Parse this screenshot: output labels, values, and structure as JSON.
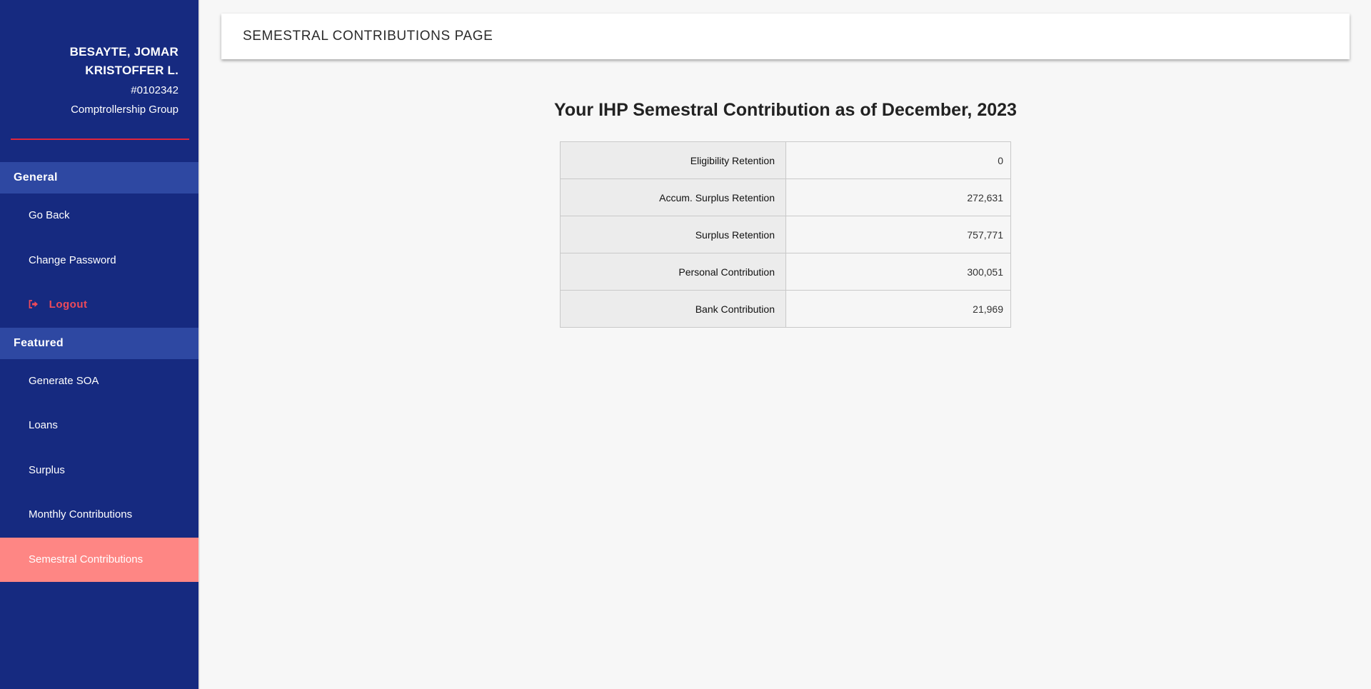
{
  "sidebar": {
    "user": {
      "name_line1": "BESAYTE, JOMAR",
      "name_line2": "KRISTOFFER L.",
      "id": "#0102342",
      "group": "Comptrollership Group"
    },
    "sections": [
      {
        "title": "General",
        "items": [
          {
            "label": "Go Back"
          },
          {
            "label": "Change Password"
          },
          {
            "label": "Logout",
            "icon": "sign-out-icon"
          }
        ]
      },
      {
        "title": "Featured",
        "items": [
          {
            "label": "Generate SOA"
          },
          {
            "label": "Loans"
          },
          {
            "label": "Surplus"
          },
          {
            "label": "Monthly Contributions"
          },
          {
            "label": "Semestral Contributions",
            "active": true
          }
        ]
      }
    ],
    "colors": {
      "background": "#162a80",
      "section_header": "#2e48a2",
      "active_item": "#fe8684",
      "logout": "#ee4a5a",
      "divider": "#e0263b"
    }
  },
  "header": {
    "title": "SEMESTRAL CONTRIBUTIONS PAGE"
  },
  "main": {
    "title": "Your IHP Semestral Contribution as of December, 2023",
    "rows": [
      {
        "label": "Eligibility Retention",
        "value": "0"
      },
      {
        "label": "Accum. Surplus Retention",
        "value": "272,631"
      },
      {
        "label": "Surplus Retention",
        "value": "757,771"
      },
      {
        "label": "Personal Contribution",
        "value": "300,051"
      },
      {
        "label": "Bank Contribution",
        "value": "21,969"
      }
    ]
  }
}
